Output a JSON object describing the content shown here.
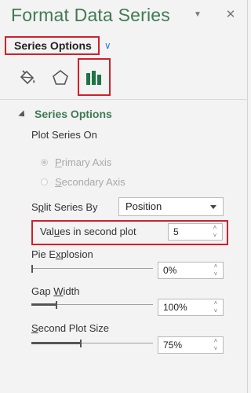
{
  "pane": {
    "title": "Format Data Series",
    "close_glyph": "✕",
    "pin_glyph": "▼"
  },
  "series_dropdown": {
    "label": "Series Options",
    "chevron": "∨"
  },
  "tabs": [
    {
      "icon": "paint-bucket-icon"
    },
    {
      "icon": "pentagon-icon"
    },
    {
      "icon": "bar-chart-icon",
      "active": true
    }
  ],
  "section": {
    "title": "Series Options",
    "plot_series_on": "Plot Series On",
    "primary_axis": {
      "pre": "",
      "u": "P",
      "post": "rimary Axis",
      "checked": true
    },
    "secondary_axis": {
      "pre": "",
      "u": "S",
      "post": "econdary Axis",
      "checked": false
    },
    "split_series_by": {
      "pre": "S",
      "u": "p",
      "post": "lit Series By",
      "value": "Position"
    },
    "values_in_second_plot": {
      "pre": "Val",
      "u": "u",
      "post": "es in second plot",
      "value": "5"
    },
    "pie_explosion": {
      "pre": "Pie E",
      "u": "x",
      "post": "plosion",
      "value": "0%",
      "fraction": 0.0
    },
    "gap_width": {
      "pre": "Gap ",
      "u": "W",
      "post": "idth",
      "value": "100%",
      "fraction": 0.2
    },
    "second_plot_size": {
      "pre": "",
      "u": "S",
      "post": "econd Plot Size",
      "value": "75%",
      "fraction": 0.4
    }
  },
  "colors": {
    "title_green": "#3f7a53",
    "highlight_red": "#d21f2b",
    "chevron_blue": "#2b7cd3",
    "bar_green": "#217346"
  }
}
